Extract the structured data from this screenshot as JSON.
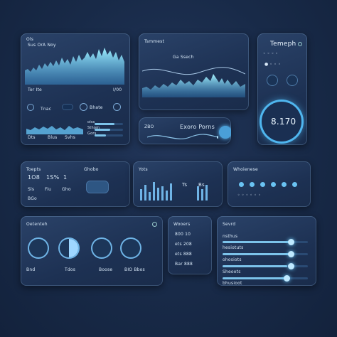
{
  "panel1": {
    "title": "Ols",
    "legend": "Sus OrA Noy",
    "axis_left": "Tor Ite",
    "axis_right": "I/00",
    "btn1": "Tnac",
    "btn2": "Bhate",
    "row1": "Dts",
    "row2": "Blus",
    "row3": "Svhs",
    "right_labels": [
      "oiss",
      "Sthom",
      "Gors"
    ]
  },
  "panel2": {
    "title": "Tsmmest",
    "subtitle": "Ga Ssech",
    "pill_number": "ZBO",
    "pill_label": "Exoro Porns"
  },
  "panel3": {
    "title": "Temeph",
    "value": "8.170"
  },
  "panel4": {
    "title": "Toepts",
    "label2": "Ghobo",
    "row_values": [
      "1O8",
      "1S%",
      "1"
    ],
    "small_labels": [
      "Sls",
      "Fiu",
      "Gho",
      "BGo"
    ]
  },
  "panel5": {
    "title": "Yots",
    "chart_labels": [
      "Ts",
      "Bs"
    ]
  },
  "panel6": {
    "title": "Whoienese"
  },
  "panel7": {
    "title": "Oetenteh",
    "footer_labels": [
      "Bnd",
      "Tdos",
      "Boose",
      "BIO Bbos"
    ]
  },
  "panel8": {
    "title": "Wooers",
    "stats": [
      "800 10",
      "ets 208",
      "ets 888",
      "Bar 888"
    ]
  },
  "panel9": {
    "title": "Sevrd",
    "rows": [
      "nsthus",
      "hesiotuts",
      "ohosiots",
      "Sheoots",
      "bhusioot"
    ]
  }
}
